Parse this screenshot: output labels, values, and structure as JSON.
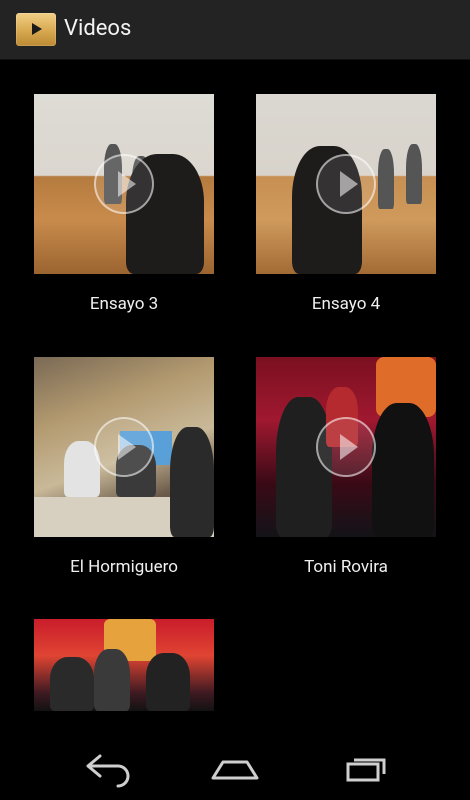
{
  "action_bar": {
    "title": "Videos",
    "icon": "video-play-icon",
    "accent_color": "#d7a850"
  },
  "videos": [
    {
      "title": "Ensayo 3"
    },
    {
      "title": "Ensayo 4"
    },
    {
      "title": "El Hormiguero"
    },
    {
      "title": "Toni Rovira"
    },
    {
      "title": ""
    }
  ],
  "nav_bar": {
    "back": "back-icon",
    "home": "home-icon",
    "recents": "recent-apps-icon"
  }
}
